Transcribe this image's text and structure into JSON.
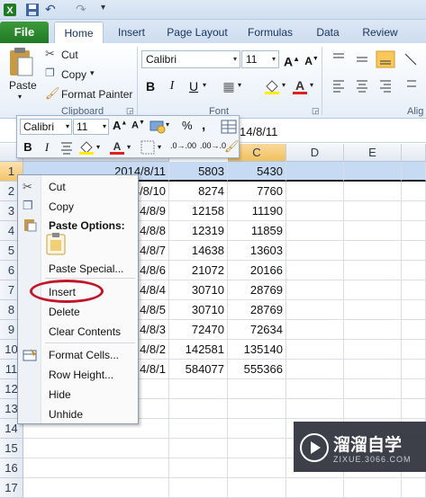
{
  "qat": {
    "undo_label": "↶",
    "redo_label": "↷"
  },
  "tabs": {
    "file": "File",
    "items": [
      "Home",
      "Insert",
      "Page Layout",
      "Formulas",
      "Data",
      "Review"
    ]
  },
  "ribbon": {
    "paste": "Paste",
    "cut": "Cut",
    "copy": "Copy",
    "copy_arrow": "▾",
    "format_painter": "Format Painter",
    "clipboard_group": "Clipboard",
    "font_group": "Font",
    "alignment_group": "Alig",
    "font_name": "Calibri",
    "font_size": "11",
    "bold": "B",
    "italic": "I",
    "underline": "U"
  },
  "formula_bar": {
    "value": "14/8/11"
  },
  "mini_toolbar": {
    "font_name": "Calibri",
    "font_size": "11",
    "bold": "B",
    "italic": "I",
    "percent": "%",
    "comma": ","
  },
  "columns": [
    "C",
    "D",
    "E"
  ],
  "rows": [
    "1",
    "2",
    "3",
    "4",
    "5",
    "6",
    "7",
    "8",
    "9",
    "10",
    "11",
    "12",
    "13",
    "14",
    "15",
    "16",
    "17"
  ],
  "table": [
    {
      "a": "2014/8/11",
      "b": "5803",
      "c": "5430"
    },
    {
      "a": "4/8/10",
      "b": "8274",
      "c": "7760"
    },
    {
      "a": "4/8/9",
      "b": "12158",
      "c": "11190"
    },
    {
      "a": "4/8/8",
      "b": "12319",
      "c": "11859"
    },
    {
      "a": "4/8/7",
      "b": "14638",
      "c": "13603"
    },
    {
      "a": "4/8/6",
      "b": "21072",
      "c": "20166"
    },
    {
      "a": "4/8/4",
      "b": "30710",
      "c": "28769"
    },
    {
      "a": "4/8/5",
      "b": "30710",
      "c": "28769"
    },
    {
      "a": "4/8/3",
      "b": "72470",
      "c": "72634"
    },
    {
      "a": "4/8/2",
      "b": "142581",
      "c": "135140"
    },
    {
      "a": "4/8/1",
      "b": "584077",
      "c": "555366"
    }
  ],
  "context_menu": {
    "cut": "Cut",
    "copy": "Copy",
    "paste_options": "Paste Options:",
    "paste_special": "Paste Special...",
    "insert": "Insert",
    "delete": "Delete",
    "clear_contents": "Clear Contents",
    "format_cells": "Format Cells...",
    "row_height": "Row Height...",
    "hide": "Hide",
    "unhide": "Unhide"
  },
  "watermark": {
    "brand": "溜溜自学",
    "url": "ZIXUE.3066.COM"
  },
  "colors": {
    "file_tab": "#1f7a24",
    "selection": "#c6daf3",
    "highlight_circle": "#c0152b"
  }
}
